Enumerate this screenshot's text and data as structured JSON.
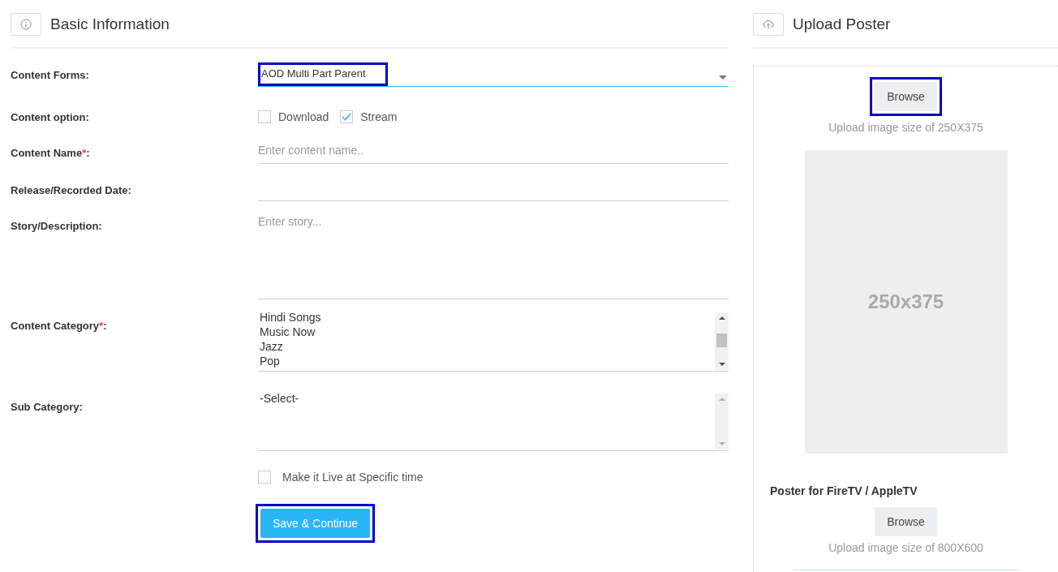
{
  "basic_information": {
    "title": "Basic Information",
    "fields": [
      {
        "kind": "select",
        "label": "Content Forms:",
        "value": "AOD Multi Part Parent",
        "highlighted": true
      },
      {
        "kind": "options",
        "label": "Content option:",
        "options": [
          {
            "label": "Download",
            "checked": false
          },
          {
            "label": "Stream",
            "checked": true
          }
        ]
      },
      {
        "kind": "text",
        "label": "Content Name",
        "required_mark": "*",
        "label_end": ":",
        "placeholder": "Enter content name.."
      },
      {
        "kind": "text",
        "label": "Release/Recorded Date:"
      },
      {
        "kind": "textarea",
        "label": "Story/Description:",
        "placeholder": "Enter story..."
      },
      {
        "kind": "listbox",
        "label": "Content Category",
        "required_mark": "*",
        "label_end": ":",
        "items": [
          "Hindi Songs",
          "Music Now",
          "Jazz",
          "Pop"
        ],
        "disabled_scroll": false
      },
      {
        "kind": "listbox",
        "label": "Sub Category:",
        "items": [
          "-Select-"
        ],
        "disabled_scroll": true
      }
    ],
    "live_option": {
      "label": "Make it Live at Specific time",
      "checked": false
    },
    "save_button": {
      "label": "Save & Continue",
      "highlighted": true
    }
  },
  "upload_poster": {
    "title": "Upload Poster",
    "browse_button": {
      "label": "Browse",
      "highlighted": true
    },
    "hint": "Upload image size of 250X375",
    "poster_placeholder": "250x375",
    "tv_poster": {
      "title": "Poster for FireTV / AppleTV",
      "browse_button": {
        "label": "Browse",
        "highlighted": false
      },
      "hint": "Upload image size of 800X600"
    }
  }
}
